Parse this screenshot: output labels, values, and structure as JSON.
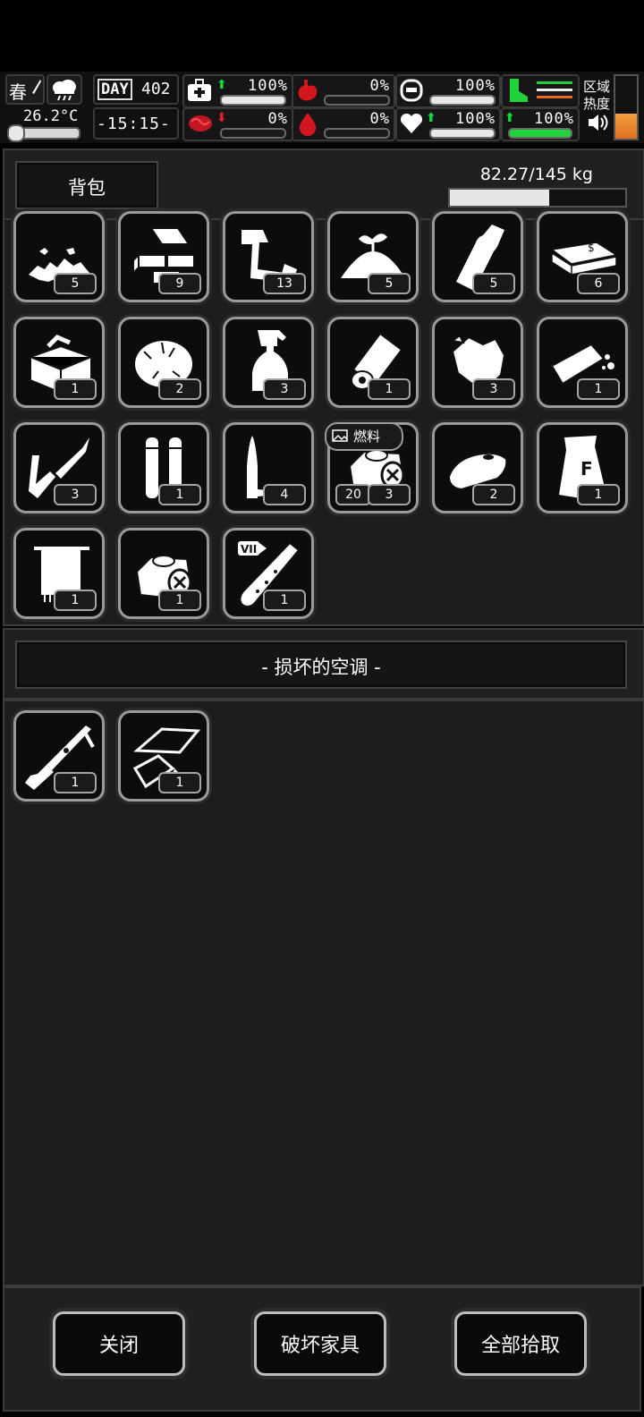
{
  "hud": {
    "season": "春",
    "temperature": "26.2°C",
    "day_label": "DAY",
    "day_number": "402",
    "time": "-15:15-",
    "health_pct": "100%",
    "hunger_pct": "0%",
    "stamina_pct": "100%",
    "infection_pct": "0%",
    "bleeding_pct": "0%",
    "mood_pct": "100%",
    "leg_pct": "100%",
    "zone_heat_label": "区域热度"
  },
  "backpack": {
    "title": "背包",
    "weight": "82.27/145 kg",
    "weight_fraction": 0.567,
    "items": [
      {
        "icon": "rubble-icon",
        "count": "5"
      },
      {
        "icon": "bricks-icon",
        "count": "9"
      },
      {
        "icon": "scrap-pipes-icon",
        "count": "13"
      },
      {
        "icon": "dirt-sprout-icon",
        "count": "5"
      },
      {
        "icon": "bottle-icon",
        "count": "5"
      },
      {
        "icon": "cash-bundle-icon",
        "count": "6"
      },
      {
        "icon": "toolbox-icon",
        "count": "1"
      },
      {
        "icon": "cotton-icon",
        "count": "2"
      },
      {
        "icon": "spray-bottle-icon",
        "count": "3"
      },
      {
        "icon": "paper-roll-icon",
        "count": "1"
      },
      {
        "icon": "crumpled-paper-icon",
        "count": "3"
      },
      {
        "icon": "soap-bar-icon",
        "count": "1"
      },
      {
        "icon": "soldering-iron-icon",
        "count": "3"
      },
      {
        "icon": "bullets-icon",
        "count": "1"
      },
      {
        "icon": "knife-icon",
        "count": "4"
      },
      {
        "icon": "fuel-canister-icon",
        "count": "3",
        "extra": "20",
        "tag": "燃料"
      },
      {
        "icon": "bread-icon",
        "count": "2"
      },
      {
        "icon": "flour-bag-icon",
        "count": "1"
      },
      {
        "icon": "towel-icon",
        "count": "1"
      },
      {
        "icon": "empty-canister-icon",
        "count": "1"
      },
      {
        "icon": "test-tube-icon",
        "count": "1"
      }
    ]
  },
  "container": {
    "title": "- 损坏的空调 -",
    "items": [
      {
        "icon": "shotgun-icon",
        "count": "1"
      },
      {
        "icon": "glass-shards-icon",
        "count": "1"
      }
    ]
  },
  "buttons": {
    "close": "关闭",
    "destroy": "破坏家具",
    "take_all": "全部拾取"
  }
}
